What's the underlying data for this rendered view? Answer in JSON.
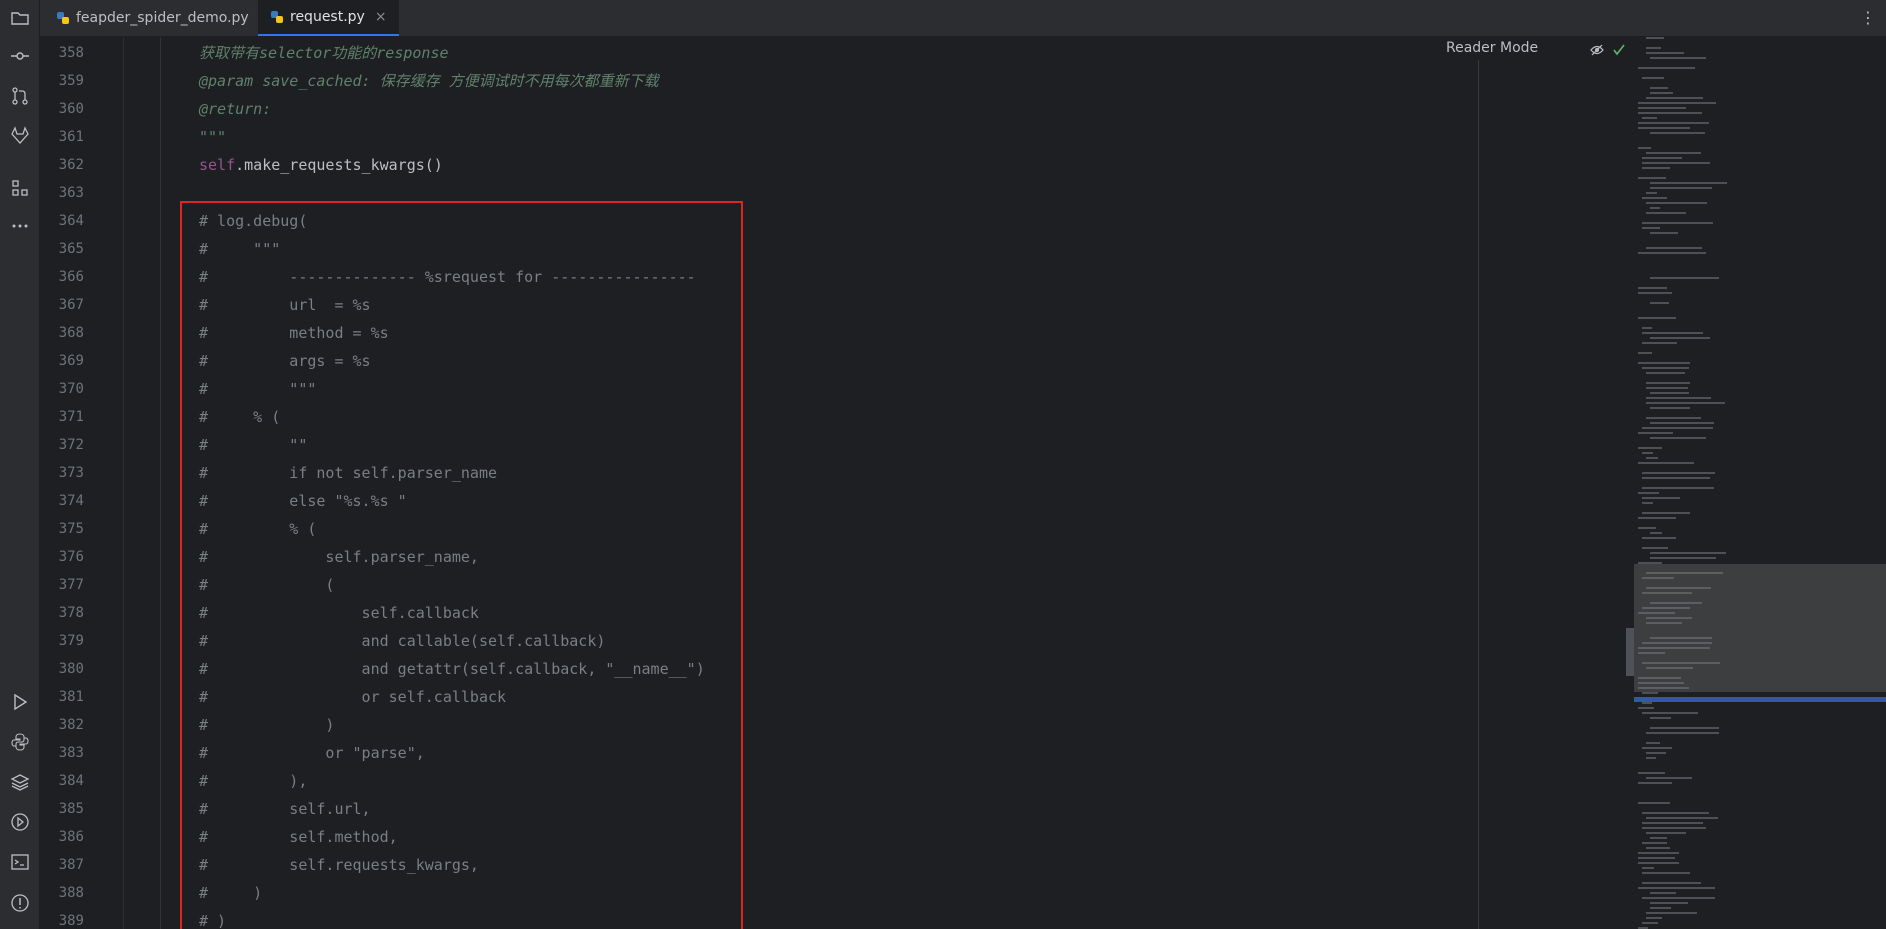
{
  "tabs": [
    {
      "label": "feapder_spider_demo.py",
      "active": false
    },
    {
      "label": "request.py",
      "active": true
    }
  ],
  "tab_close": "×",
  "kebab": "⋮",
  "reader_mode": "Reader Mode",
  "colors": {
    "accent": "#3574f0",
    "highlight_border": "#e02424",
    "docstring": "#5f826b",
    "comment": "#7a7e85",
    "self_keyword": "#94558d"
  },
  "activity_icons": [
    "folder-icon",
    "commit-icon",
    "pull-request-icon",
    "gitlab-icon",
    "structure-icon",
    "more-icon",
    "run-icon",
    "python-icon",
    "layers-icon",
    "services-icon",
    "terminal-icon",
    "problems-icon"
  ],
  "lines": [
    {
      "n": "358",
      "segments": [
        {
          "t": "获取带有",
          "c": "doc"
        },
        {
          "t": "selector",
          "c": "doc"
        },
        {
          "t": "功能的",
          "c": "doc"
        },
        {
          "t": "response",
          "c": "doc"
        }
      ]
    },
    {
      "n": "359",
      "segments": [
        {
          "t": "@param save_cached: 保存缓存 方便调试时不用每次都重新下载",
          "c": "doc"
        }
      ]
    },
    {
      "n": "360",
      "segments": [
        {
          "t": "@return:",
          "c": "doc"
        }
      ]
    },
    {
      "n": "361",
      "segments": [
        {
          "t": "\"\"\"",
          "c": "doc"
        }
      ]
    },
    {
      "n": "362",
      "segments": [
        {
          "t": "self",
          "c": "self"
        },
        {
          "t": ".make_requests_kwargs()",
          "c": "plain"
        }
      ]
    },
    {
      "n": "363",
      "segments": [
        {
          "t": "",
          "c": "plain"
        }
      ]
    },
    {
      "n": "364",
      "segments": [
        {
          "t": "# log.debug(",
          "c": "cmt"
        }
      ]
    },
    {
      "n": "365",
      "segments": [
        {
          "t": "#     \"\"\"",
          "c": "cmt"
        }
      ]
    },
    {
      "n": "366",
      "segments": [
        {
          "t": "#         -------------- %srequest for ----------------",
          "c": "cmt"
        }
      ]
    },
    {
      "n": "367",
      "segments": [
        {
          "t": "#         url  = %s",
          "c": "cmt"
        }
      ]
    },
    {
      "n": "368",
      "segments": [
        {
          "t": "#         method = %s",
          "c": "cmt"
        }
      ]
    },
    {
      "n": "369",
      "segments": [
        {
          "t": "#         args = %s",
          "c": "cmt"
        }
      ]
    },
    {
      "n": "370",
      "segments": [
        {
          "t": "#         \"\"\"",
          "c": "cmt"
        }
      ]
    },
    {
      "n": "371",
      "segments": [
        {
          "t": "#     % (",
          "c": "cmt"
        }
      ]
    },
    {
      "n": "372",
      "segments": [
        {
          "t": "#         \"\"",
          "c": "cmt"
        }
      ]
    },
    {
      "n": "373",
      "segments": [
        {
          "t": "#         if not self.parser_name",
          "c": "cmt"
        }
      ]
    },
    {
      "n": "374",
      "segments": [
        {
          "t": "#         else \"%s.%s \"",
          "c": "cmt"
        }
      ]
    },
    {
      "n": "375",
      "segments": [
        {
          "t": "#         % (",
          "c": "cmt"
        }
      ]
    },
    {
      "n": "376",
      "segments": [
        {
          "t": "#             self.parser_name,",
          "c": "cmt"
        }
      ]
    },
    {
      "n": "377",
      "segments": [
        {
          "t": "#             (",
          "c": "cmt"
        }
      ]
    },
    {
      "n": "378",
      "segments": [
        {
          "t": "#                 self.callback",
          "c": "cmt"
        }
      ]
    },
    {
      "n": "379",
      "segments": [
        {
          "t": "#                 and callable(self.callback)",
          "c": "cmt"
        }
      ]
    },
    {
      "n": "380",
      "segments": [
        {
          "t": "#                 and getattr(self.callback, \"__name__\")",
          "c": "cmt"
        }
      ]
    },
    {
      "n": "381",
      "segments": [
        {
          "t": "#                 or self.callback",
          "c": "cmt"
        }
      ]
    },
    {
      "n": "382",
      "segments": [
        {
          "t": "#             )",
          "c": "cmt"
        }
      ]
    },
    {
      "n": "383",
      "segments": [
        {
          "t": "#             or \"parse\",",
          "c": "cmt"
        }
      ]
    },
    {
      "n": "384",
      "segments": [
        {
          "t": "#         ),",
          "c": "cmt"
        }
      ]
    },
    {
      "n": "385",
      "segments": [
        {
          "t": "#         self.url,",
          "c": "cmt"
        }
      ]
    },
    {
      "n": "386",
      "segments": [
        {
          "t": "#         self.method,",
          "c": "cmt"
        }
      ]
    },
    {
      "n": "387",
      "segments": [
        {
          "t": "#         self.requests_kwargs,",
          "c": "cmt"
        }
      ]
    },
    {
      "n": "388",
      "segments": [
        {
          "t": "#     )",
          "c": "cmt"
        }
      ]
    },
    {
      "n": "389",
      "segments": [
        {
          "t": "# )",
          "c": "cmt"
        }
      ]
    }
  ]
}
